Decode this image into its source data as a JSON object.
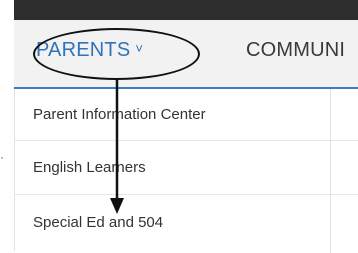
{
  "nav": {
    "items": [
      {
        "label": "PARENTS",
        "chevron": "˅",
        "active": true
      },
      {
        "label": "COMMUNI",
        "active": false
      }
    ],
    "accent_color": "#2f74b8"
  },
  "dropdown": {
    "items": [
      {
        "label": "Parent Information Center"
      },
      {
        "label": "English Learners"
      },
      {
        "label": "Special Ed and 504"
      }
    ]
  },
  "annotation": {
    "shape": "ellipse",
    "arrow": "arrow-down"
  }
}
